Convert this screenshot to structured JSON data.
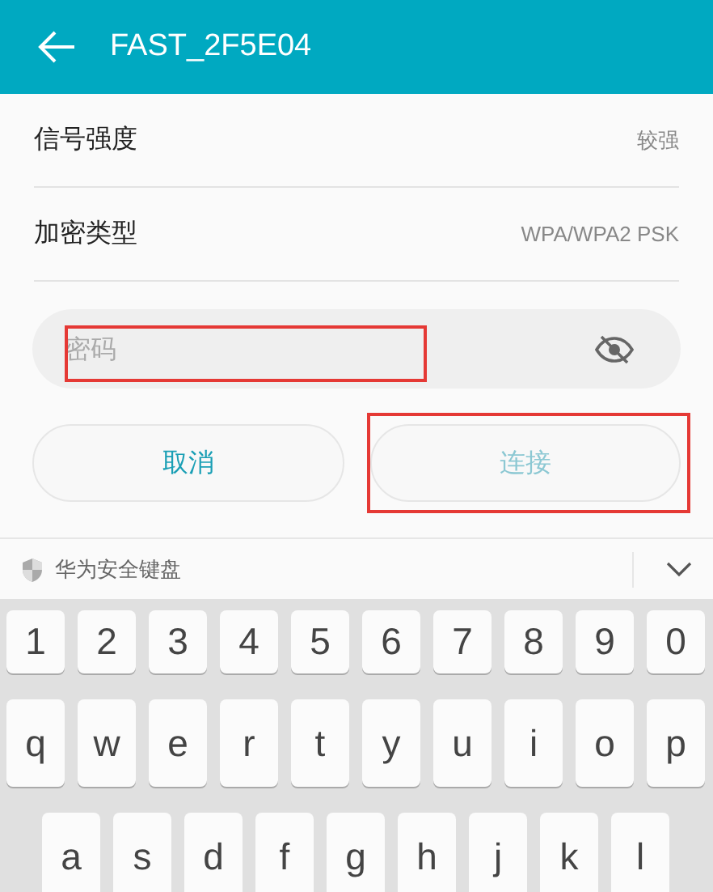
{
  "header": {
    "title": "FAST_2F5E04"
  },
  "info_rows": [
    {
      "label": "信号强度",
      "value": "较强"
    },
    {
      "label": "加密类型",
      "value": "WPA/WPA2 PSK"
    }
  ],
  "password": {
    "placeholder": "密码",
    "highlighted": true
  },
  "buttons": [
    {
      "label": "取消",
      "disabled": false,
      "highlighted": false
    },
    {
      "label": "连接",
      "disabled": true,
      "highlighted": true
    }
  ],
  "keyboard_bar": {
    "title": "华为安全键盘"
  },
  "keyboard_rows": [
    [
      "1",
      "2",
      "3",
      "4",
      "5",
      "6",
      "7",
      "8",
      "9",
      "0"
    ],
    [
      "q",
      "w",
      "e",
      "r",
      "t",
      "y",
      "u",
      "i",
      "o",
      "p"
    ],
    [
      "a",
      "s",
      "d",
      "f",
      "g",
      "h",
      "j",
      "k",
      "l"
    ]
  ]
}
